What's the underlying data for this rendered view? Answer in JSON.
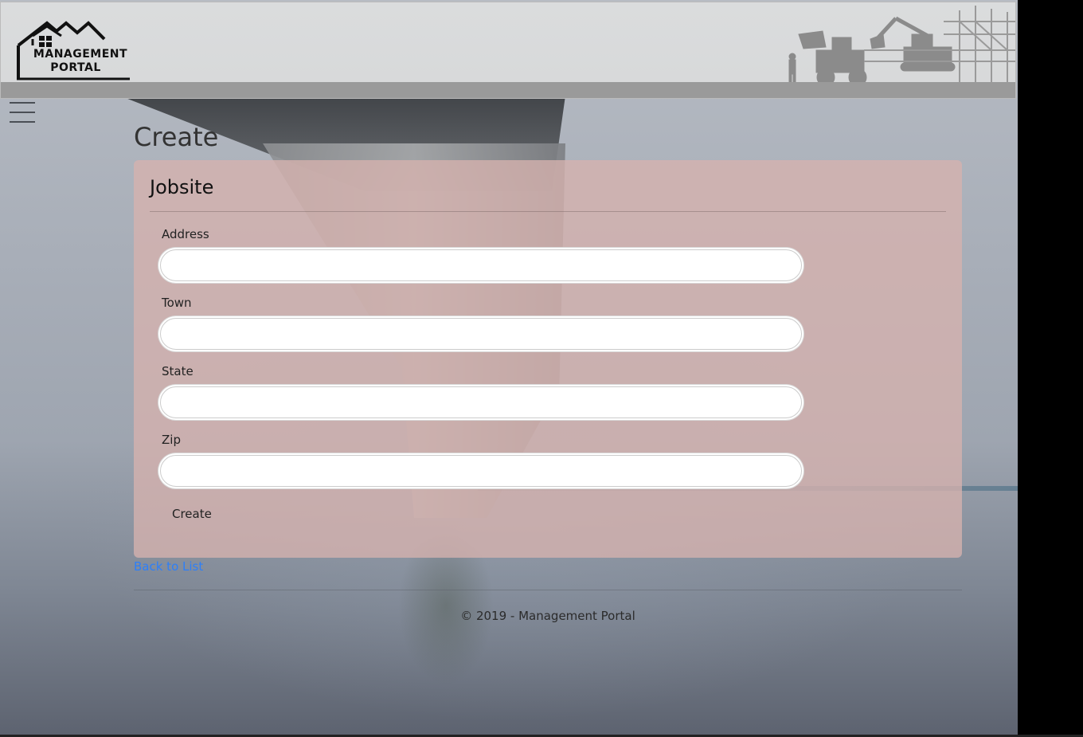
{
  "header": {
    "logo_line1": "MANAGEMENT",
    "logo_line2": "PORTAL"
  },
  "nav": {
    "menu_icon": "hamburger-menu-icon"
  },
  "page": {
    "title": "Create"
  },
  "form": {
    "heading": "Jobsite",
    "fields": [
      {
        "label": "Address",
        "value": "",
        "placeholder": ""
      },
      {
        "label": "Town",
        "value": "",
        "placeholder": ""
      },
      {
        "label": "State",
        "value": "",
        "placeholder": ""
      },
      {
        "label": "Zip",
        "value": "",
        "placeholder": ""
      }
    ],
    "submit_label": "Create"
  },
  "links": {
    "back": "Back to List"
  },
  "footer": {
    "text": "© 2019 - Management Portal"
  },
  "colors": {
    "link": "#2d7ff9",
    "card": "#d6b2ae"
  }
}
